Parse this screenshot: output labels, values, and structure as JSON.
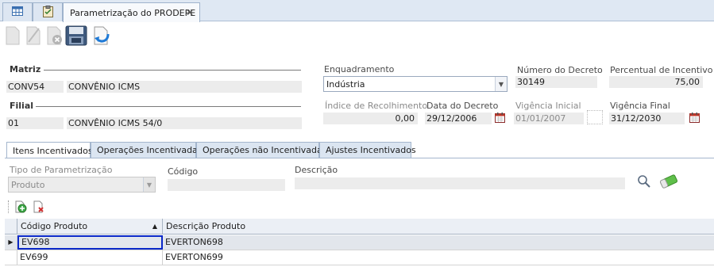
{
  "window_tab": {
    "title": "Parametrização do PRODEPE",
    "close_glyph": "✕"
  },
  "toolbar": {
    "buttons": [
      "new-icon",
      "edit-icon",
      "delete-icon",
      "save-icon",
      "undo-icon"
    ]
  },
  "matriz": {
    "label": "Matriz",
    "code": "CONV54",
    "name": "CONVÊNIO ICMS"
  },
  "filial": {
    "label": "Filial",
    "code": "01",
    "name": "CONVÊNIO ICMS 54/0"
  },
  "enquadramento": {
    "label": "Enquadramento",
    "value": "Indústria"
  },
  "numero_decreto": {
    "label": "Número do Decreto",
    "value": "30149"
  },
  "percentual_incentivo": {
    "label": "Percentual de Incentivo",
    "value": "75,00"
  },
  "indice_recolhimento": {
    "label": "Índice de Recolhimento",
    "value": "0,00"
  },
  "data_decreto": {
    "label": "Data do Decreto",
    "value": "29/12/2006"
  },
  "vigencia_inicial": {
    "label": "Vigência Inicial",
    "value": "01/01/2007"
  },
  "vigencia_final": {
    "label": "Vigência Final",
    "value": "31/12/2030"
  },
  "tabs": [
    {
      "label": "Itens Incentivados",
      "active": true
    },
    {
      "label": "Operações Incentivadas",
      "active": false
    },
    {
      "label": "Operações não Incentivadas",
      "active": false
    },
    {
      "label": "Ajustes Incentivados",
      "active": false
    }
  ],
  "filters": {
    "tipo_label": "Tipo de Parametrização",
    "tipo_value": "Produto",
    "codigo_label": "Código",
    "codigo_value": "",
    "descricao_label": "Descrição",
    "descricao_value": ""
  },
  "grid": {
    "columns": [
      "Código Produto",
      "Descrição Produto"
    ],
    "rows": [
      {
        "codigo": "EV698",
        "descricao": "EVERTON698",
        "selected": true
      },
      {
        "codigo": "EV699",
        "descricao": "EVERTON699",
        "selected": false
      }
    ]
  },
  "colors": {
    "accent": "#0a28c8",
    "calendar_red": "#c0392b",
    "tab_strip": "#dfe8f3"
  }
}
